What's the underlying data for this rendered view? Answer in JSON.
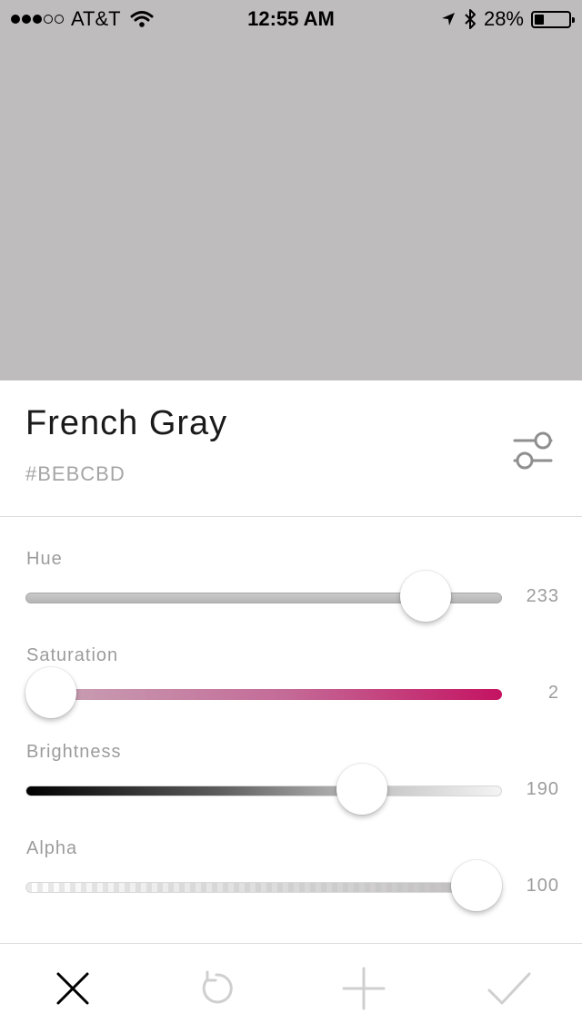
{
  "status_bar": {
    "carrier": "AT&T",
    "time": "12:55 AM",
    "battery_percent": "28%",
    "battery_level": 0.28,
    "signal_strength": 3,
    "signal_max": 5
  },
  "preview": {
    "color": "#BEBCBD"
  },
  "color": {
    "name": "French Gray",
    "hex": "#BEBCBD"
  },
  "sliders": [
    {
      "label": "Hue",
      "value": "233",
      "max": 360,
      "position": 0.88
    },
    {
      "label": "Saturation",
      "value": "2",
      "max": 100,
      "position": 0.0
    },
    {
      "label": "Brightness",
      "value": "190",
      "max": 255,
      "position": 0.73
    },
    {
      "label": "Alpha",
      "value": "100",
      "max": 100,
      "position": 1.0
    }
  ],
  "toolbar": {
    "buttons": [
      {
        "icon": "close-icon",
        "color": "#000000"
      },
      {
        "icon": "undo-icon",
        "color": "#cfcfcf"
      },
      {
        "icon": "plus-icon",
        "color": "#cfcfcf"
      },
      {
        "icon": "checkmark-icon",
        "color": "#cfcfcf"
      }
    ]
  }
}
